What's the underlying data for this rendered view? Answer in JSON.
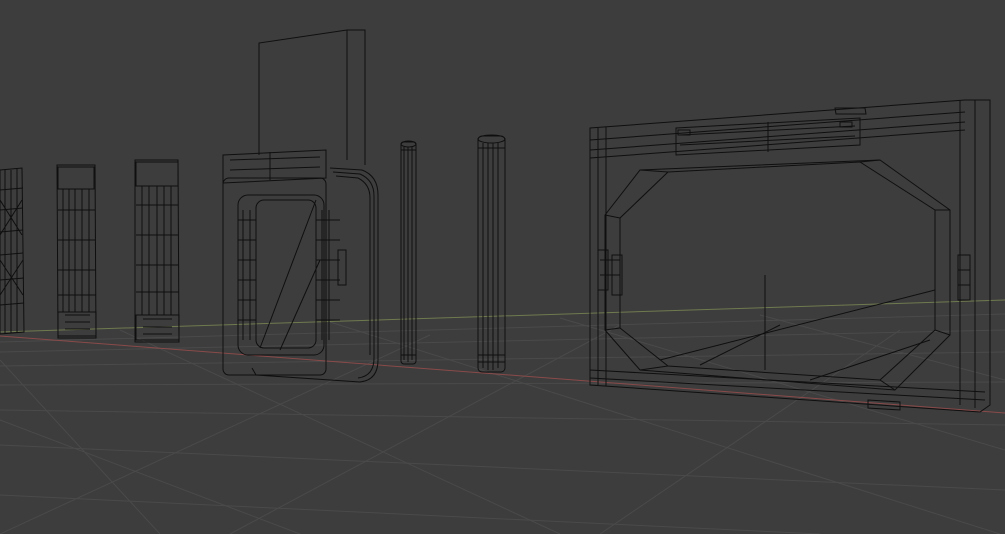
{
  "viewport": {
    "mode": "wireframe",
    "background_color": "#3d3d3d",
    "grid_color": "#4a4a4a",
    "x_axis_color": "#8a4a4a",
    "y_axis_color": "#6f7a4f",
    "wire_color": "#0f0f0f"
  },
  "objects": [
    {
      "kind": "door-panel"
    },
    {
      "kind": "door-panel"
    },
    {
      "kind": "door-panel"
    },
    {
      "kind": "door-frame-small"
    },
    {
      "kind": "pillar-thin"
    },
    {
      "kind": "pillar-thick"
    },
    {
      "kind": "door-frame-large"
    }
  ]
}
